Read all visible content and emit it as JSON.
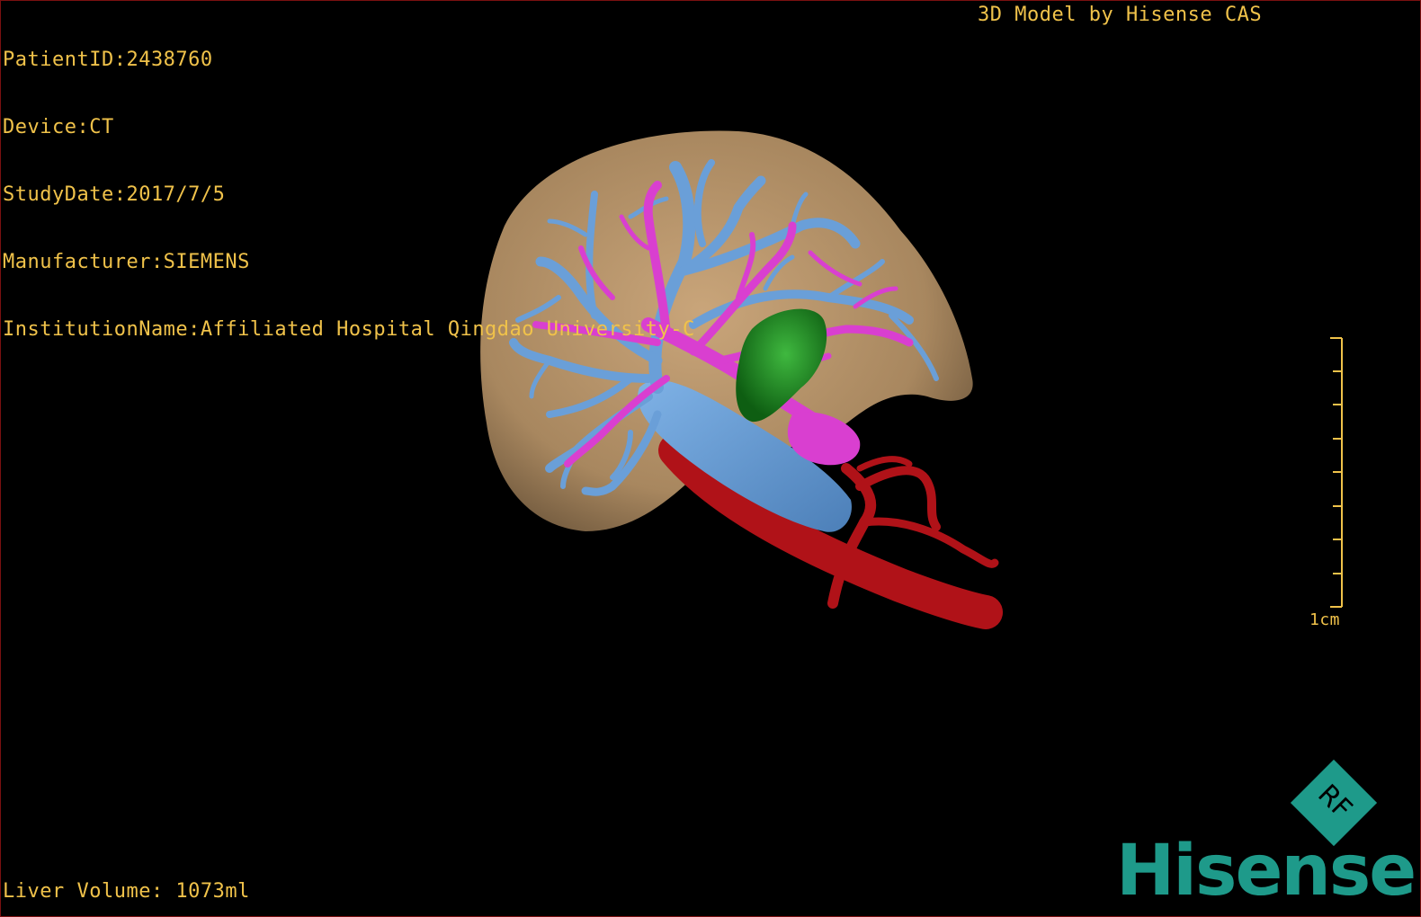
{
  "patient": {
    "id_line": "PatientID:2438760",
    "device_line": "Device:CT",
    "study_date_line": "StudyDate:2017/7/5",
    "manufacturer_line": "Manufacturer:SIEMENS",
    "institution_line": "InstitutionName:Affiliated Hospital Qingdao University-C"
  },
  "header": {
    "credit": "3D Model by Hisense CAS"
  },
  "footer": {
    "liver_volume": "Liver Volume: 1073ml"
  },
  "scale": {
    "label": "1cm"
  },
  "logo": {
    "badge_text": "RF",
    "brand": "Hisense"
  },
  "colors": {
    "overlay_text": "#f0c24a",
    "liver": "#b9946a",
    "portal_vein": "#6a9fd8",
    "hepatic_vessel": "#d93fd0",
    "tumor": "#1f8c1f",
    "artery": "#b01218",
    "brand": "#1e9a8a"
  },
  "icons": {
    "logo_badge": "rf-diamond-icon"
  }
}
